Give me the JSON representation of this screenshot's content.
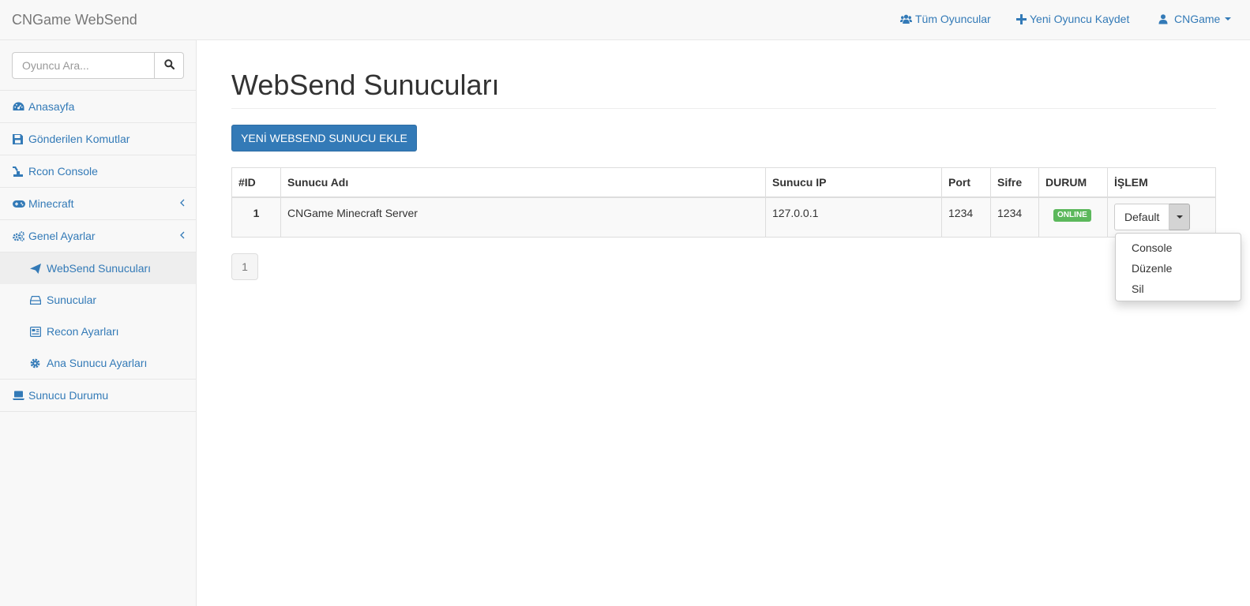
{
  "navbar": {
    "brand": "CNGame WebSend",
    "links": {
      "all_players": "Tüm Oyuncular",
      "new_player": "Yeni Oyuncu Kaydet",
      "user": "CNGame"
    }
  },
  "sidebar": {
    "search": {
      "placeholder": "Oyuncu Ara..."
    },
    "items": {
      "home": "Anasayfa",
      "sent_commands": "Gönderilen Komutlar",
      "rcon_console": "Rcon Console",
      "minecraft": "Minecraft",
      "general_settings": "Genel Ayarlar",
      "server_status": "Sunucu Durumu"
    },
    "sub_items": {
      "websend_servers": "WebSend Sunucuları",
      "servers": "Sunucular",
      "recon_settings": "Recon Ayarları",
      "main_server_settings": "Ana Sunucu Ayarları"
    }
  },
  "main": {
    "title": "WebSend Sunucuları",
    "add_button": "YENİ WEBSEND SUNUCU EKLE",
    "table": {
      "headers": {
        "id": "#ID",
        "name": "Sunucu Adı",
        "ip": "Sunucu IP",
        "port": "Port",
        "password": "Sifre",
        "status": "DURUM",
        "action": "İŞLEM"
      },
      "rows": [
        {
          "id": "1",
          "name": "CNGame Minecraft Server",
          "ip": "127.0.0.1",
          "port": "1234",
          "password": "1234",
          "status": "ONLINE",
          "action_button": "Default"
        }
      ]
    },
    "dropdown": {
      "console": "Console",
      "edit": "Düzenle",
      "delete": "Sil"
    },
    "pagination": {
      "current": "1"
    }
  },
  "colors": {
    "link": "#337ab7",
    "primary_button": "#337ab7",
    "online_badge": "#5cb85c"
  }
}
